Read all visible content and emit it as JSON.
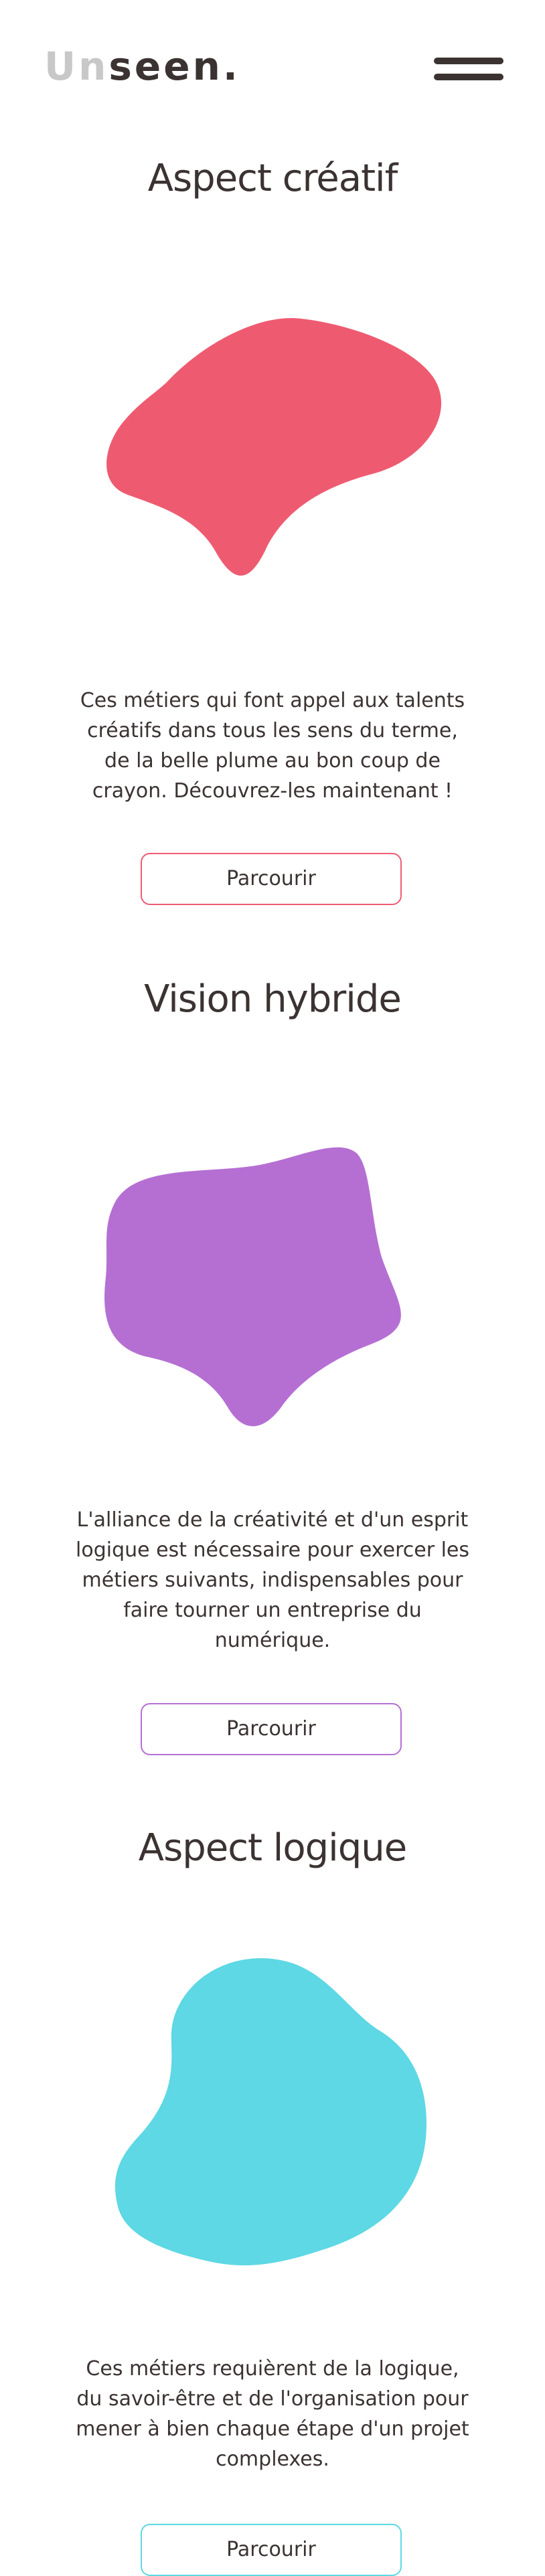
{
  "header": {
    "logo_light": "Un",
    "logo_dark": "seen.",
    "menu_icon": "hamburger-menu-icon"
  },
  "sections": [
    {
      "title": "Aspect créatif",
      "description": "Ces métiers qui font appel aux talents créatifs dans tous les sens du terme, de la belle plume au bon coup de crayon. Découvrez-les maintenant !",
      "button_label": "Parcourir",
      "color": "#ee5b71"
    },
    {
      "title": "Vision hybride",
      "description": "L'alliance de la créativité et d'un esprit logique est nécessaire pour exercer les métiers suivants, indispensables pour faire tourner un entreprise du numérique.",
      "button_label": "Parcourir",
      "color": "#b56fd3"
    },
    {
      "title": "Aspect logique",
      "description": "Ces métiers requièrent de la logique, du savoir-être et de l'organisation pour mener à bien chaque étape d'un projet complexes.",
      "button_label": "Parcourir",
      "color": "#5dd8e4"
    }
  ]
}
